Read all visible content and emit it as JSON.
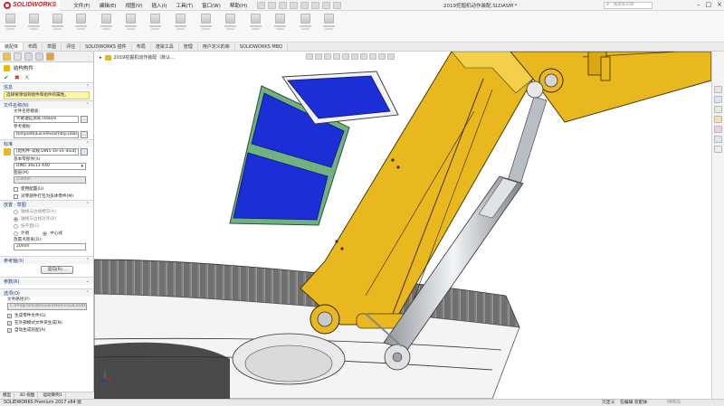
{
  "app": {
    "brand": "SOLIDWORKS",
    "document_title": "2019挖掘机动作装配.SLDASM *",
    "search_placeholder": "搜索知识库",
    "window_controls": [
      "–",
      "□",
      "×"
    ]
  },
  "menu": [
    "文件(F)",
    "编辑(E)",
    "视图(V)",
    "插入(I)",
    "工具(T)",
    "窗口(W)",
    "帮助(H)"
  ],
  "tabs": [
    "装配体",
    "布局",
    "草图",
    "评估",
    "SOLIDWORKS 插件",
    "布局",
    "渲染工具",
    "管理",
    "用户定义的库",
    "SOLIDWORKS MBD"
  ],
  "breadcrumb": {
    "label": "2019挖掘机动作装配（默认..."
  },
  "property_manager": {
    "title": "结构构件",
    "sections": {
      "message": {
        "title": "信息",
        "text": "选择要添加到组件和组件的属性。"
      },
      "file": {
        "title": "文件名称(N)",
        "template_label": "文件名称模板:",
        "template_value": "大臂油缸测试.sldasm",
        "path_label": "参考模板:",
        "path_value": "template\\ExcelAssembly.sldasmd"
      },
      "standard": {
        "title": "标准",
        "profile_value": "[结构件-常规 DIN5-10-16 dout]",
        "std_label": "基本零部件(S)",
        "std_value": "DIN5 30x13 X40",
        "material_label": "图层(M)",
        "material_value": "2.9mm",
        "chk1": "使用配置(U)",
        "chk2": "对零部件打包为多体零件(M)"
      },
      "placement": {
        "title": "放置 · 草图",
        "r1": "轴线与边线相交(A)",
        "r2": "轴线与边线对齐(B)",
        "r3": "按平面(C)",
        "r4": "外侧",
        "r5": "中心线",
        "length_label": "放置点距离(D):",
        "length_value": "20mm"
      },
      "reference": {
        "title": "参考轴(X)",
        "button": "反向(R)..."
      },
      "params": {
        "title": "参数(R)"
      },
      "options": {
        "title": "选项(O)",
        "path_label": "文件路径(P)",
        "path_value": "C:\\ProgramData\\SolidWorks\\SOLIDWOR",
        "c1": "生成零件文件(G)",
        "c2": "在外部模式文件夹生成(N)",
        "c3": "自动生成装配(A)"
      }
    }
  },
  "panel_bottom_tabs": [
    "模型",
    "3D 视图",
    "运动算例1"
  ],
  "status": {
    "left": "SOLIDWORKS Premium 2017 x64 版",
    "s1": "欠定义",
    "s2": "在编辑 装配体",
    "s3": "MMGS"
  },
  "colors": {
    "yellow_arm": "#e9b81f",
    "blue_glass": "#1c2fd6",
    "green_frame": "#7fb98a",
    "track_gray": "#8a8a8a",
    "cylinder": "#cfd3d8",
    "brand_red": "#d42027"
  }
}
